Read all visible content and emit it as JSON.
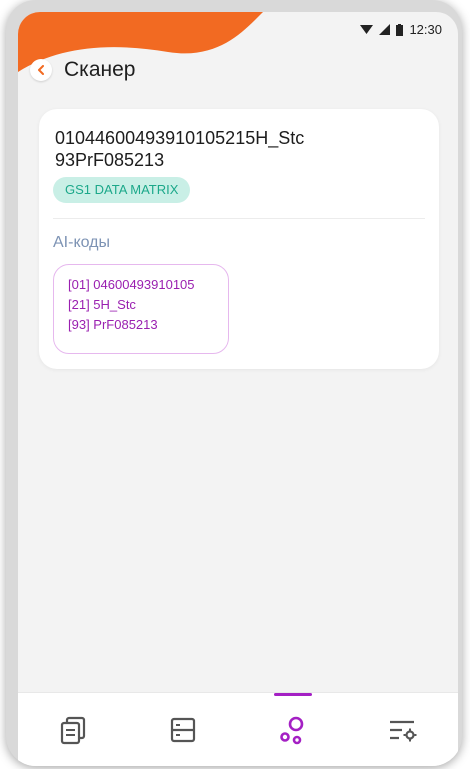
{
  "status_bar": {
    "time": "12:30"
  },
  "header": {
    "title": "Сканер",
    "accent_color": "#f26a22"
  },
  "scan_result": {
    "code_text": "0104460049391010 5215H_Stc 93PrF085213",
    "code_line_1": "010446004939101052 15H_Stc",
    "code_display": "0104460049391010521 5H_Stc\n93PrF085213",
    "type_label": "GS1 DATA MATRIX",
    "ai_heading": "AI-коды",
    "ai_codes": [
      "[01] 04600493910105",
      "[21] 5H_Stc",
      "[93] PrF085213"
    ]
  },
  "bottom_nav": {
    "items": [
      {
        "icon": "copy-icon"
      },
      {
        "icon": "list-icon"
      },
      {
        "icon": "scanner-icon",
        "active": true
      },
      {
        "icon": "settings-icon"
      }
    ],
    "active_color": "#a420c4",
    "inactive_color": "#555555"
  }
}
